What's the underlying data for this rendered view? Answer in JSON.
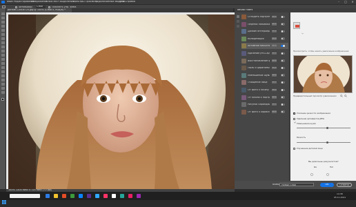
{
  "menubar": {
    "items": [
      "Файл",
      "Редактирование",
      "Изображение",
      "Слои",
      "Текст",
      "Выделение",
      "Фильтр",
      "3D",
      "Просмотр",
      "Подключаемые модули",
      "Окно",
      "Справка"
    ],
    "win_min": "–",
    "win_max": "□",
    "win_close": "✕"
  },
  "options": {
    "auto_select": "Автовыбор:",
    "layer": "Слой",
    "transform_controls": "Показать упр. элем."
  },
  "document_tab": {
    "title": "portrait-1300x725.jpg @ 100% (Слой 0, RGB/8) *"
  },
  "status": {
    "zoom": "100%",
    "dims": "1300 пикс x 725 пикс (72 ppi)"
  },
  "neural_filters": {
    "title": "Neural Filters",
    "filters": [
      {
        "label": "Сгладить портрет",
        "badge": "Бета",
        "on": false
      },
      {
        "label": "Перенос макияжа",
        "badge": "Бета",
        "on": false
      },
      {
        "label": "Дизайн интерьера",
        "badge": "Бета",
        "on": false
      },
      {
        "label": "Колоризация",
        "badge": "Бета",
        "on": false
      },
      {
        "label": "Активное масштаб.",
        "badge": "Бета",
        "on": true
      },
      {
        "label": "Удаление JPEG-артеф.",
        "badge": "Бета",
        "on": false
      },
      {
        "label": "Восстановление фото",
        "badge": "Бета",
        "on": false
      },
      {
        "label": "Пыль и царапины",
        "badge": "Бета",
        "on": false
      },
      {
        "label": "Уменьшение шума",
        "badge": "Бета",
        "on": false
      },
      {
        "label": "Очищение лица",
        "badge": "Бета",
        "on": false
      },
      {
        "label": "От фото к эскизу",
        "badge": "Бета",
        "on": false
      },
      {
        "label": "От эскиза к портрету",
        "badge": "Бета",
        "on": false
      },
      {
        "label": "Рисунок карандашом",
        "badge": "Бета",
        "on": false
      },
      {
        "label": "От фото к карикатуре",
        "badge": "Бета",
        "on": false
      }
    ],
    "detail": {
      "info_text": "Просмотрите, чтобы начать увеличение изображения",
      "preview_caption": "Предварительный просмотр (увеличение)",
      "check_sharpen": "Усиление резкости изображения",
      "check_jpeg": "Удаление артефактов JPEG",
      "label_noise": "Уменьшение шума",
      "label_sharpen": "Резкость",
      "check_face": "Улучшение деталей лица",
      "question": "Вы довольны результатом?",
      "yes": "Да",
      "no": "Нет"
    },
    "output_label": "Вывод",
    "output_value": "Новый слой",
    "ok": "OK",
    "cancel": "Отмена"
  },
  "taskbar": {
    "time": "14:38",
    "date": "05.11.2021",
    "icon_colors": [
      "#2d7be5",
      "#f2c12e",
      "#e34c26",
      "#3c9a3c",
      "#0a84ff",
      "#5c2d91",
      "#31a8ff",
      "#ff3366",
      "#ffffff",
      "#26a69a",
      "#e91e63",
      "#9c27b0"
    ]
  }
}
